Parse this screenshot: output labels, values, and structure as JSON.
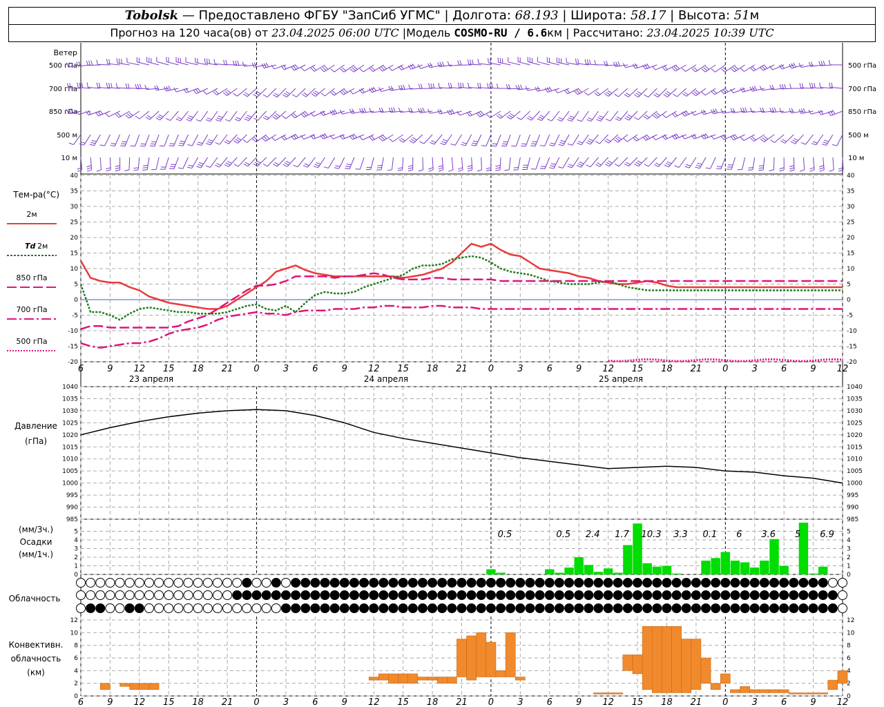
{
  "header": {
    "station": "Tobolsk",
    "dash": " — ",
    "provider": "Предоставлено ФГБУ \"ЗапСиб УГМС\"",
    "lon_label": "Долгота:",
    "lon_value": "68.193",
    "lat_label": "Широта:",
    "lat_value": "58.17",
    "alt_label": "Высота:",
    "alt_value": "51",
    "alt_unit": "м",
    "forecast_label": "Прогноз на 120 часа(ов) от",
    "forecast_start": "23.04.2025 06:00 UTC",
    "model_label": "Модель",
    "model_name": "COSMO-RU / 6.6",
    "model_unit": "км",
    "computed_label": "Рассчитано:",
    "computed_value": "23.04.2025 10:39 UTC",
    "sep": "|"
  },
  "wind_panel": {
    "title": "Ветер",
    "levels": [
      "500 гПа",
      "700 гПа",
      "850 гПа",
      "500 м",
      "10  м"
    ],
    "level_dirs_deg": [
      260,
      250,
      240,
      225,
      200
    ],
    "color": "#7a3cc7"
  },
  "temp_panel": {
    "title": "Тем-ра(°C)",
    "legend": [
      {
        "label": "2м",
        "color": "#e83a3a",
        "style": "solid"
      },
      {
        "label_it": "Td",
        "label": "2м",
        "color": "#1f7a1f",
        "style": "dotted"
      },
      {
        "label": "850 гПа",
        "color": "#e0137a",
        "style": "dash"
      },
      {
        "label": "700 гПа",
        "color": "#e0137a",
        "style": "dashdot"
      },
      {
        "label": "500 гПа",
        "color": "#e0137a",
        "style": "dot"
      }
    ],
    "yticks": [
      "40",
      "35",
      "30",
      "25",
      "20",
      "15",
      "10",
      "5",
      "0",
      "-5",
      "-10",
      "-15",
      "-20"
    ],
    "days": [
      "23 апреля",
      "24 апреля",
      "25 апреля"
    ]
  },
  "pressure_panel": {
    "title": "Давление",
    "unit": "(гПа)",
    "yticks": [
      "1040",
      "1035",
      "1030",
      "1025",
      "1020",
      "1015",
      "1010",
      "1005",
      "1000",
      "995",
      "990",
      "985"
    ]
  },
  "precip_panel": {
    "unit1": "(мм/3ч.)",
    "title": "Осадки",
    "unit2": "(мм/1ч.)",
    "yticks": [
      "5",
      "4",
      "3",
      "2",
      "1",
      "0"
    ],
    "color": "#00dd00"
  },
  "cloud_panel": {
    "title": "Облачность"
  },
  "conv_panel": {
    "title1": "Конвективн.",
    "title2": "облачность",
    "unit": "(км)",
    "yticks": [
      "12",
      "10",
      "8",
      "6",
      "4",
      "2",
      "0"
    ],
    "color": "#f08a2c"
  },
  "time_axis": {
    "labels": [
      "6",
      "9",
      "12",
      "15",
      "18",
      "21",
      "0",
      "3",
      "6",
      "9",
      "12",
      "15",
      "18",
      "21",
      "0",
      "3",
      "6",
      "9",
      "12",
      "15",
      "18",
      "21",
      "0",
      "3",
      "6",
      "9",
      "12"
    ]
  },
  "chart_data": {
    "type": "line",
    "time_hours_from_start": [
      0,
      3,
      6,
      9,
      12,
      15,
      18,
      21,
      24,
      27,
      30,
      33,
      36,
      39,
      42,
      45,
      48,
      51,
      54,
      57,
      60,
      63,
      66,
      69,
      72,
      75,
      78
    ],
    "temperature": {
      "x_hours": [
        0,
        1,
        2,
        3,
        4,
        5,
        6,
        7,
        8,
        9,
        10,
        11,
        12,
        13,
        14,
        15,
        16,
        17,
        18,
        19,
        20,
        21,
        22,
        23,
        24,
        25,
        26,
        27,
        28,
        29,
        30,
        31,
        32,
        33,
        34,
        35,
        36,
        37,
        38,
        39,
        40,
        41,
        42,
        43,
        44,
        45,
        46,
        47,
        48,
        49,
        50,
        51,
        52,
        53,
        54,
        55,
        56,
        57,
        58,
        59,
        60,
        61,
        62,
        63,
        64,
        65,
        66,
        67,
        68,
        69,
        70,
        71,
        72,
        73,
        74,
        75,
        76,
        77,
        78
      ],
      "series": [
        {
          "name": "2м",
          "values": [
            12.5,
            7,
            6,
            5.5,
            5.5,
            4,
            3,
            1,
            0,
            -1,
            -1.5,
            -2,
            -2.5,
            -3,
            -3,
            -2,
            0,
            2,
            4,
            6,
            9,
            10,
            11,
            9.5,
            8.5,
            8,
            7.5,
            7.5,
            7.5,
            7.5,
            7.5,
            7.5,
            7.5,
            7,
            7.5,
            8,
            9,
            10,
            12,
            15,
            18,
            17,
            18,
            16,
            14.5,
            14,
            12,
            10,
            9.5,
            9,
            8.5,
            7.5,
            7,
            6,
            5.5,
            5,
            5,
            5.5,
            6,
            5.5,
            4.5,
            4,
            4,
            4,
            4,
            4,
            4,
            4,
            4,
            4,
            4,
            4,
            4,
            4,
            4,
            4,
            4,
            4,
            4
          ]
        },
        {
          "name": "Td 2м",
          "values": [
            5,
            -4,
            -4,
            -5,
            -6.5,
            -4.5,
            -3,
            -2.5,
            -3,
            -3.5,
            -4,
            -4,
            -4.5,
            -4.5,
            -4.5,
            -4,
            -3,
            -2,
            -1.5,
            -3,
            -3.5,
            -2,
            -4,
            -1,
            1.5,
            2.5,
            2,
            2,
            2.5,
            4,
            5,
            6,
            7,
            8,
            10,
            11,
            11,
            11.5,
            13,
            13.5,
            14,
            13.5,
            12,
            10,
            9,
            8.5,
            8,
            7,
            6,
            5.5,
            5,
            5,
            5,
            5.5,
            6,
            5,
            4,
            3.5,
            3,
            3,
            3,
            3,
            3,
            3,
            3,
            3,
            3,
            3,
            3,
            3,
            3,
            3,
            3,
            3,
            3,
            3,
            3,
            3,
            3
          ]
        },
        {
          "name": "850 гПа",
          "values": [
            -9.5,
            -8.5,
            -8.5,
            -9,
            -9,
            -9,
            -9,
            -9,
            -9,
            -9,
            -8.5,
            -7,
            -6,
            -5,
            -3,
            -1,
            1,
            3,
            4.5,
            4.5,
            5,
            6,
            7.5,
            7.5,
            7.5,
            7.5,
            7,
            7.5,
            7.5,
            8,
            8.5,
            8,
            7,
            6.5,
            6.5,
            6.5,
            7,
            7,
            6.5,
            6.5,
            6.5,
            6.5,
            6.5,
            6,
            6,
            6,
            6,
            6,
            6,
            6,
            6,
            6,
            6,
            6,
            6,
            6,
            6,
            6,
            6,
            6,
            6,
            6,
            6,
            6,
            6,
            6,
            6,
            6,
            6,
            6,
            6,
            6,
            6,
            6,
            6,
            6,
            6,
            6,
            6
          ]
        },
        {
          "name": "700 гПа",
          "values": [
            -14,
            -15,
            -15.5,
            -15,
            -14.5,
            -14,
            -14,
            -13.5,
            -12.5,
            -11,
            -10,
            -9.5,
            -9,
            -8,
            -6.5,
            -5.5,
            -5,
            -4.5,
            -4,
            -4.5,
            -4.5,
            -5,
            -4,
            -3.5,
            -3.5,
            -3.5,
            -3,
            -3,
            -3,
            -2.5,
            -2.5,
            -2,
            -2,
            -2.5,
            -2.5,
            -2.5,
            -2,
            -2,
            -2.5,
            -2.5,
            -2.5,
            -3,
            -3,
            -3,
            -3,
            -3,
            -3,
            -3,
            -3,
            -3,
            -3,
            -3,
            -3,
            -3,
            -3,
            -3,
            -3,
            -3,
            -3,
            -3,
            -3,
            -3,
            -3,
            -3,
            -3,
            -3,
            -3,
            -3,
            -3,
            -3,
            -3,
            -3,
            -3,
            -3,
            -3,
            -3,
            -3,
            -3,
            -3
          ]
        }
      ],
      "ylim": [
        -20,
        40
      ]
    },
    "pressure": {
      "x_hours": [
        0,
        3,
        6,
        9,
        12,
        15,
        18,
        21,
        24,
        27,
        30,
        33,
        36,
        39,
        42,
        45,
        48,
        51,
        54,
        57,
        60,
        63,
        66,
        69,
        72,
        75,
        78
      ],
      "values": [
        1020,
        1023,
        1025.5,
        1027.5,
        1029,
        1030,
        1030.5,
        1030,
        1028,
        1025,
        1021,
        1018.5,
        1016.5,
        1014.5,
        1012.5,
        1010.5,
        1009,
        1007.5,
        1006,
        1006.5,
        1007,
        1006.5,
        1005,
        1004.5,
        1003,
        1002,
        1000
      ],
      "ylim": [
        985,
        1040
      ]
    },
    "precipitation": {
      "x_hours_start": [
        0,
        3,
        6,
        9,
        12,
        15,
        18,
        21,
        24,
        27,
        30,
        33,
        36,
        39,
        42,
        45,
        48,
        51,
        54,
        57,
        60,
        63,
        66,
        69,
        72,
        75,
        78
      ],
      "labels_3h": [
        "0.5",
        "0.5",
        "2.4",
        "1.7",
        "10.3",
        "3.3",
        "0.1",
        "6",
        "3.6",
        "5",
        "6.9"
      ],
      "hourly_mm": [
        0.6,
        0.2,
        0,
        0,
        0,
        0,
        0.6,
        0.2,
        0.8,
        2,
        1.1,
        0.3,
        0.7,
        0.2,
        3.4,
        5.9,
        1.3,
        0.9,
        1,
        0.1,
        0,
        0,
        1.6,
        1.9,
        2.6,
        1.6,
        1.4,
        0.8,
        1.6,
        4.1,
        1,
        0,
        6,
        0.1,
        0.9
      ],
      "ylim": [
        0,
        6
      ]
    },
    "convective_cloud_km": {
      "ylim": [
        0,
        12
      ],
      "bars": [
        {
          "x": 2.5,
          "bottom": 1.0,
          "top": 2.0
        },
        {
          "x": 4.5,
          "bottom": 1.5,
          "top": 2.0
        },
        {
          "x": 5.5,
          "bottom": 1.0,
          "top": 2.0
        },
        {
          "x": 6.5,
          "bottom": 1.0,
          "top": 2.0
        },
        {
          "x": 7.5,
          "bottom": 1.0,
          "top": 2.0
        },
        {
          "x": 30,
          "bottom": 2.5,
          "top": 3.0
        },
        {
          "x": 31,
          "bottom": 2.5,
          "top": 3.5
        },
        {
          "x": 32,
          "bottom": 2.0,
          "top": 3.5
        },
        {
          "x": 33,
          "bottom": 2.0,
          "top": 3.5
        },
        {
          "x": 34,
          "bottom": 2.0,
          "top": 3.5
        },
        {
          "x": 35,
          "bottom": 2.5,
          "top": 3.0
        },
        {
          "x": 36,
          "bottom": 2.5,
          "top": 3.0
        },
        {
          "x": 37,
          "bottom": 2.0,
          "top": 3.0
        },
        {
          "x": 38,
          "bottom": 2.0,
          "top": 3.0
        },
        {
          "x": 39,
          "bottom": 3.0,
          "top": 9.0
        },
        {
          "x": 40,
          "bottom": 2.5,
          "top": 9.5
        },
        {
          "x": 41,
          "bottom": 3.0,
          "top": 10.0
        },
        {
          "x": 42,
          "bottom": 3.0,
          "top": 8.5
        },
        {
          "x": 43,
          "bottom": 3.0,
          "top": 4.0
        },
        {
          "x": 44,
          "bottom": 3.0,
          "top": 10.0
        },
        {
          "x": 45,
          "bottom": 2.5,
          "top": 3.0
        },
        {
          "x": 53,
          "bottom": 0.3,
          "top": 0.5
        },
        {
          "x": 54,
          "bottom": 0.3,
          "top": 0.5
        },
        {
          "x": 55,
          "bottom": 0.3,
          "top": 0.5
        },
        {
          "x": 56,
          "bottom": 4.0,
          "top": 6.5
        },
        {
          "x": 57,
          "bottom": 3.5,
          "top": 6.5
        },
        {
          "x": 58,
          "bottom": 1.0,
          "top": 11.0
        },
        {
          "x": 59,
          "bottom": 0.5,
          "top": 11.0
        },
        {
          "x": 60,
          "bottom": 0.5,
          "top": 11.0
        },
        {
          "x": 61,
          "bottom": 0.5,
          "top": 11.0
        },
        {
          "x": 62,
          "bottom": 0.5,
          "top": 9.0
        },
        {
          "x": 63,
          "bottom": 1.0,
          "top": 9.0
        },
        {
          "x": 64,
          "bottom": 2.0,
          "top": 6.0
        },
        {
          "x": 65,
          "bottom": 1.0,
          "top": 2.0
        },
        {
          "x": 66,
          "bottom": 2.0,
          "top": 3.5
        },
        {
          "x": 67,
          "bottom": 0.5,
          "top": 1.0
        },
        {
          "x": 68,
          "bottom": 0.5,
          "top": 1.5
        },
        {
          "x": 69,
          "bottom": 0.5,
          "top": 1.0
        },
        {
          "x": 70,
          "bottom": 0.5,
          "top": 1.0
        },
        {
          "x": 71,
          "bottom": 0.5,
          "top": 1.0
        },
        {
          "x": 72,
          "bottom": 0.5,
          "top": 1.0
        },
        {
          "x": 73,
          "bottom": 0.3,
          "top": 0.5
        },
        {
          "x": 74,
          "bottom": 0.3,
          "top": 0.5
        },
        {
          "x": 75,
          "bottom": 0.3,
          "top": 0.5
        },
        {
          "x": 76,
          "bottom": 0.3,
          "top": 0.5
        },
        {
          "x": 77,
          "bottom": 1.0,
          "top": 2.5
        },
        {
          "x": 78,
          "bottom": 2.0,
          "top": 4.0
        }
      ]
    },
    "cloud_cover_rows": {
      "levels": [
        "high",
        "middle",
        "low"
      ],
      "high": "00000000000000000O00O0OOOOOOOOOOOOOOOOOOOOOOOOOOOOOOOOOOOOOOOOOOOOOOOOOOOOOOO",
      "middle": "0000000000000000OOOOOOOOOOOOOOOOOOOOOOOOOOOOOOOOOOOOOOOOOOOOOOOOOOOOOOOOOOOOOO",
      "low": "0OO00OO00000000000000OOOOOOOOOOOOOOOOOOOOOOOOOOOOOOOOOOOOOOOOOOOOOOOOOOOOOOOOO"
    }
  }
}
